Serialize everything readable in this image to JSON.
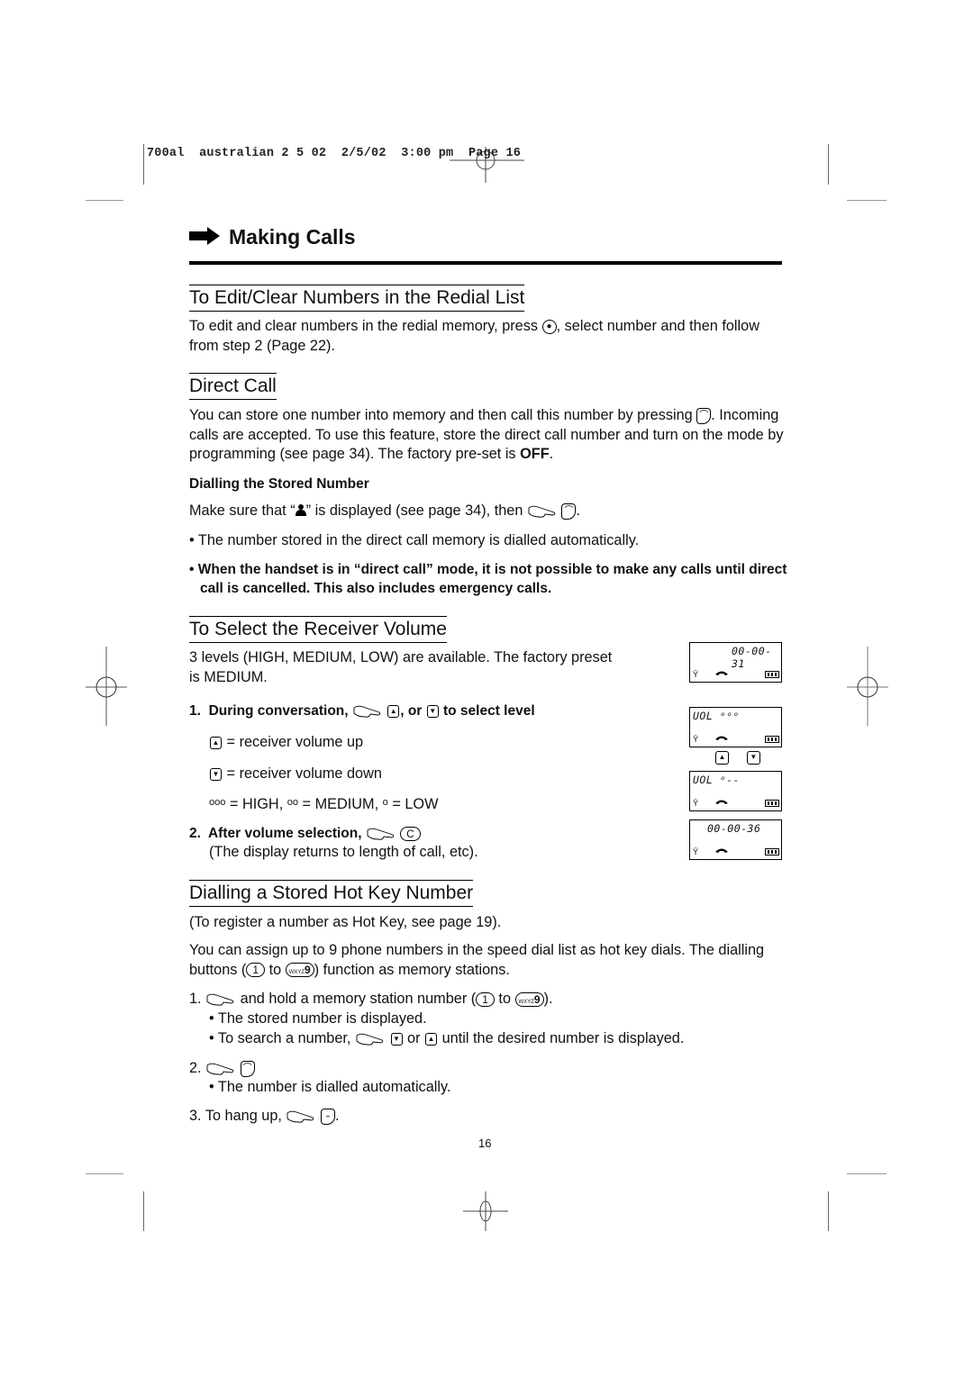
{
  "slug": "700al  australian 2 5 02  2/5/02  3:00 pm  Page 16",
  "chapter": {
    "icon": "arrow-right-icon",
    "title": "Making Calls"
  },
  "sections": {
    "redial": {
      "heading": "To Edit/Clear Numbers in the Redial List",
      "text_before_key": "To edit and clear numbers in the redial memory, press",
      "key_icon": "navigation-key-icon",
      "text_after_key": ", select number and then follow from step 2 (Page 22)."
    },
    "direct_call": {
      "heading": "Direct Call",
      "para_1a": "You can store one number into memory and then call this number by pressing",
      "para_1b": ". Incoming calls are accepted. To use this feature, store the direct call number and turn on the mode by programming (see page 34). The factory pre-set is",
      "para_1_bold": "OFF",
      "para_1_end": ".",
      "subheading": "Dialling the Stored Number",
      "make_sure_a": "Make sure that “",
      "make_sure_icon": "person-icon",
      "make_sure_b": "” is displayed (see page 34), then",
      "bullet_1": "• The number stored in the direct call memory is dialled automatically.",
      "bullet_2": "• When the handset is in “direct call” mode, it is not possible to make any calls until direct call is cancelled. This also includes emergency calls."
    },
    "volume": {
      "heading": "To Select the Receiver Volume",
      "intro": "3 levels (HIGH, MEDIUM, LOW) are available. The factory preset is MEDIUM.",
      "step1_label": "1.",
      "step1_a": "During conversation,",
      "step1_b": ", or",
      "step1_c": "to select level",
      "up_desc": "= receiver volume up",
      "down_desc": "= receiver volume down",
      "levels": "ᵒᵒᵒ = HIGH, ᵒᵒ = MEDIUM, ᵒ = LOW",
      "step2_label": "2.",
      "step2_a": "After volume selection,",
      "step2_key": "C",
      "step2_note": "(The display returns to length of call, etc).",
      "up_key": "▲",
      "down_key": "▼"
    },
    "hotkey": {
      "heading": "Dialling a Stored Hot Key Number",
      "register_note": "(To register a number as Hot Key, see page 19).",
      "assign_a": "You can assign up to 9 phone numbers in the speed dial list as hot key dials. The dialling buttons (",
      "key_1": "1",
      "to": "to",
      "key_9": "9",
      "key_9_letters": "WXYZ",
      "assign_b": ") function as memory stations.",
      "step1_label": "1.",
      "step1_a": "and hold a memory station number (",
      "step1_b": ").",
      "step1_bullet1": "• The stored number is displayed.",
      "step1_bullet2_a": "• To search a number,",
      "step1_bullet2_or": "or",
      "step1_bullet2_b": "until the desired number is displayed.",
      "step2_label": "2.",
      "step2_bullet": "• The number is dialled automatically.",
      "step3_label": "3.",
      "step3_a": "To hang up,",
      "step3_end": "."
    }
  },
  "lcd_displays": [
    {
      "text": "00-00-31",
      "icons": [
        "antenna-icon",
        "handset-icon",
        "battery-icon"
      ]
    },
    {
      "text": "UOL ᵒᵒᵒ",
      "icons": [
        "antenna-icon",
        "handset-icon",
        "battery-icon"
      ]
    },
    {
      "text": "UOL ᵒ--",
      "icons": [
        "antenna-icon",
        "handset-icon",
        "battery-icon"
      ]
    },
    {
      "text": "00-00-36",
      "icons": [
        "antenna-icon",
        "handset-icon",
        "battery-icon"
      ]
    }
  ],
  "lcd_keys": {
    "up": "▲",
    "down": "▼"
  },
  "page_number": "16"
}
